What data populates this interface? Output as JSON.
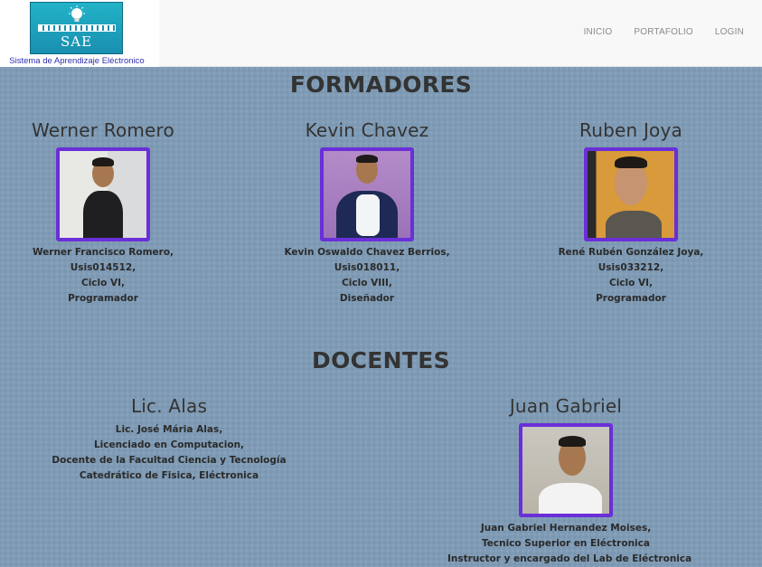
{
  "header": {
    "logo_text": "SAE",
    "brand_subtitle": "Sistema de Aprendizaje Eléctronico",
    "nav": [
      "INICIO",
      "PORTAFOLIO",
      "LOGIN"
    ]
  },
  "formadores": {
    "title": "FORMADORES",
    "people": [
      {
        "name": "Werner Romero",
        "lines": [
          "Werner Francisco Romero,",
          "Usis014512,",
          "Ciclo VI,",
          "Programador"
        ]
      },
      {
        "name": "Kevin Chavez",
        "lines": [
          "Kevin Oswaldo Chavez Berrios,",
          "Usis018011,",
          "Ciclo VIII,",
          "Diseñador"
        ]
      },
      {
        "name": "Ruben Joya",
        "lines": [
          "René Rubén González Joya,",
          "Usis033212,",
          "Ciclo VI,",
          "Programador"
        ]
      }
    ]
  },
  "docentes": {
    "title": "DOCENTES",
    "people": [
      {
        "name": "Lic. Alas",
        "lines": [
          "Lic. José Mária Alas,",
          "Licenciado en Computacion,",
          "Docente de la Facultad Ciencia y Tecnología",
          "Catedrático de Fisica, Eléctronica"
        ]
      },
      {
        "name": "Juan Gabriel",
        "lines": [
          "Juan Gabriel Hernandez Moises,",
          "Tecnico Superior en Eléctronica",
          "Instructor y encargado del Lab de Eléctronica"
        ]
      }
    ]
  },
  "colors": {
    "page_background": "#7f9bb5",
    "photo_border": "#6a2fd8",
    "heading_text": "#333333",
    "brand_subtitle": "#2f2fb0"
  }
}
